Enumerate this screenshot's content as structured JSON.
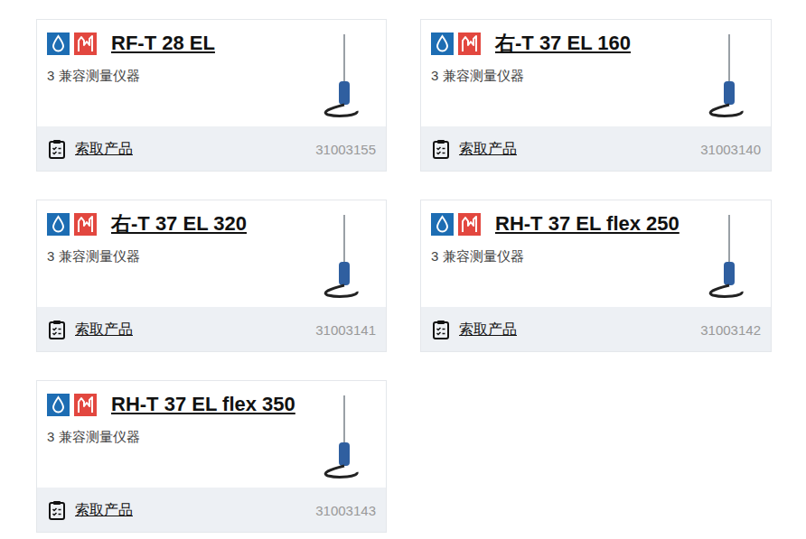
{
  "products": [
    {
      "name": "RF-T 28 EL",
      "subtitle": "3 兼容测量仪器",
      "action": "索取产品",
      "code": "31003155"
    },
    {
      "name": "右-T 37 EL 160",
      "subtitle": "3 兼容测量仪器",
      "action": "索取产品",
      "code": "31003140"
    },
    {
      "name": "右-T 37 EL 320",
      "subtitle": "3 兼容测量仪器",
      "action": "索取产品",
      "code": "31003141"
    },
    {
      "name": "RH-T 37 EL flex 250",
      "subtitle": "3 兼容测量仪器",
      "action": "索取产品",
      "code": "31003142"
    },
    {
      "name": "RH-T 37 EL flex 350",
      "subtitle": "3 兼容测量仪器",
      "action": "索取产品",
      "code": "31003143"
    }
  ]
}
